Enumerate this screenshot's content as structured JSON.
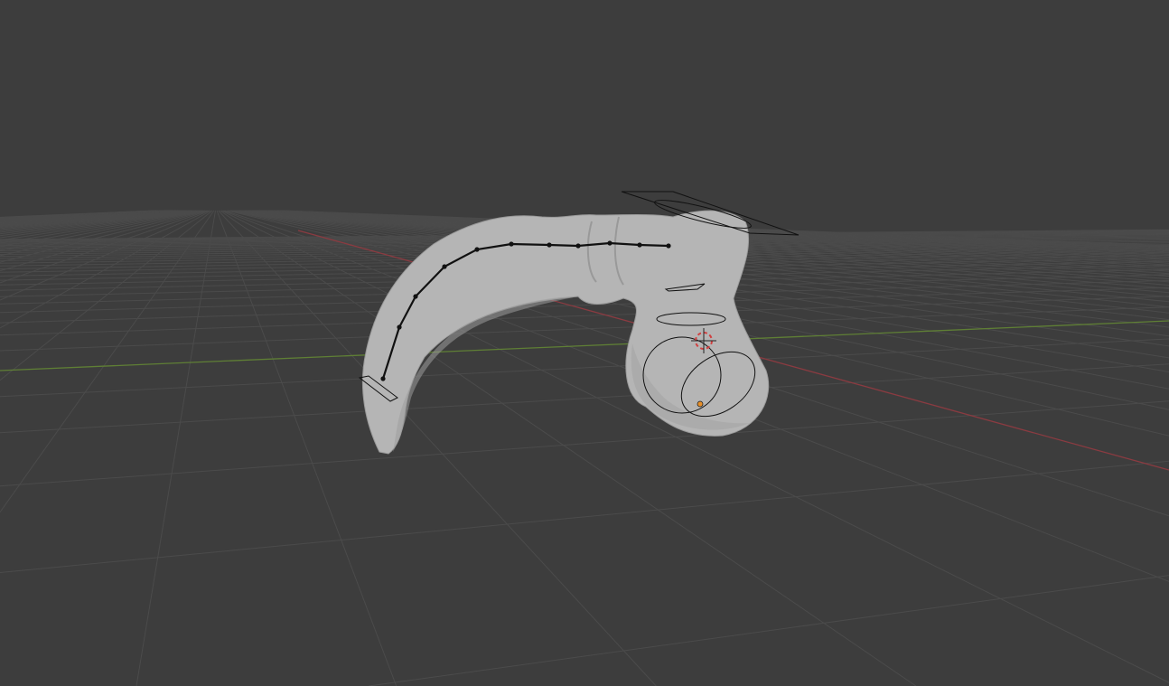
{
  "viewport": {
    "mode": "3D Viewport",
    "colors": {
      "background": "#3d3d3d",
      "grid": "#4b4b4b",
      "x_axis": "#8a3b41",
      "y_axis": "#5f7f35",
      "mesh": "#b9b9b9",
      "mesh_shadow": "#8d8d8d",
      "curve": "#111111",
      "origin": "#e8902a",
      "cursor": "#d04040"
    }
  }
}
